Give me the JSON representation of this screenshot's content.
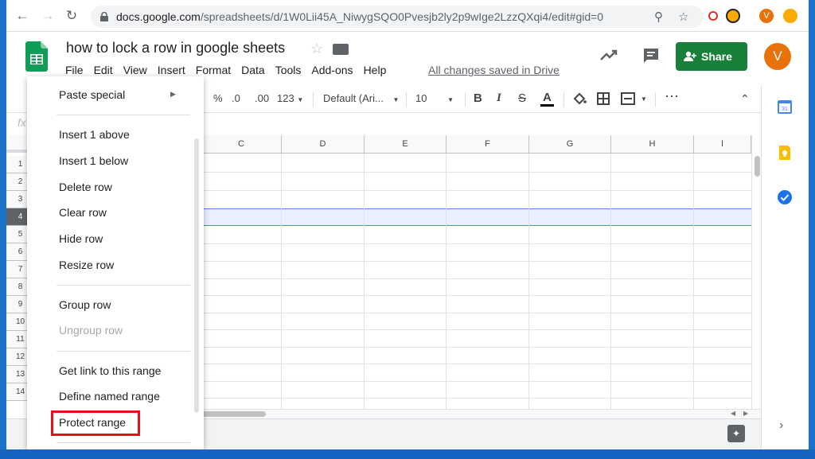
{
  "browser": {
    "url_domain": "docs.google.com",
    "url_path": "/spreadsheets/d/1W0Lii45A_NiwygSQO0Pvesjb2ly2p9wIge2LzzQXqi4/edit#gid=0",
    "profile_initial": "V"
  },
  "doc": {
    "title": "how to lock a row in google sheets",
    "saved_status": "All changes saved in Drive"
  },
  "menu": [
    "File",
    "Edit",
    "View",
    "Insert",
    "Format",
    "Data",
    "Tools",
    "Add-ons",
    "Help"
  ],
  "header": {
    "share_label": "Share",
    "avatar_initial": "V"
  },
  "toolbar": {
    "percent": "%",
    "decrease_decimal": ".0",
    "increase_decimal": ".00",
    "more_formats": "123",
    "font": "Default (Ari...",
    "font_size": "10",
    "bold": "B",
    "italic": "I",
    "strike": "S",
    "text_color": "A",
    "more": "⋯"
  },
  "formula_bar": {
    "fx": "fx"
  },
  "grid": {
    "columns": [
      "C",
      "D",
      "E",
      "F",
      "G",
      "H",
      "I"
    ],
    "rows": [
      "1",
      "2",
      "3",
      "4",
      "5",
      "6",
      "7",
      "8",
      "9",
      "10",
      "11",
      "12",
      "13",
      "14"
    ],
    "selected_row": "4"
  },
  "context_menu": {
    "paste_special": "Paste special",
    "insert_above": "Insert 1 above",
    "insert_below": "Insert 1 below",
    "delete_row": "Delete row",
    "clear_row": "Clear row",
    "hide_row": "Hide row",
    "resize_row": "Resize row",
    "group_row": "Group row",
    "ungroup_row": "Ungroup row",
    "get_link": "Get link to this range",
    "define_named_range": "Define named range",
    "protect_range": "Protect range"
  },
  "colors": {
    "share_green": "#188038",
    "avatar_orange": "#e8710a",
    "highlight_red": "#e3101c",
    "selection_blue": "#4a86e8"
  }
}
